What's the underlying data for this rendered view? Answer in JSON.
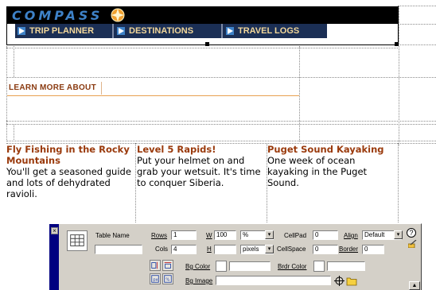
{
  "header": {
    "logo": "COMPASS",
    "nav": [
      {
        "label": "TRIP PLANNER"
      },
      {
        "label": "DESTINATIONS"
      },
      {
        "label": "TRAVEL LOGS"
      }
    ]
  },
  "learn_more": {
    "label": "LEARN MORE ABOUT"
  },
  "columns": [
    {
      "title": "Fly Fishing in the Rocky Mountains",
      "body": "You'll get a seasoned guide and lots of dehydrated ravioli."
    },
    {
      "title": "Level 5 Rapids!",
      "body": "Put your helmet on and grab your wetsuit. It's time to conquer Siberia."
    },
    {
      "title": "Puget Sound Kayaking",
      "body": "One week of ocean kayaking in the Puget Sound."
    }
  ],
  "inspector": {
    "table_name_label": "Table Name",
    "table_name_value": "",
    "rows_label": "Rows",
    "rows_value": "1",
    "cols_label": "Cols",
    "cols_value": "4",
    "w_label": "W",
    "w_value": "100",
    "w_unit": "%",
    "h_label": "H",
    "h_value": "",
    "h_unit": "pixels",
    "cellpad_label": "CellPad",
    "cellpad_value": "0",
    "cellspace_label": "CellSpace",
    "cellspace_value": "0",
    "align_label": "Align",
    "align_value": "Default",
    "border_label": "Border",
    "border_value": "0",
    "bgcolor_label": "Bg Color",
    "bgcolor_value": "",
    "brdrcolor_label": "Brdr Color",
    "brdrcolor_value": "",
    "bgimage_label": "Bg Image",
    "bgimage_value": "",
    "help_glyph": "?",
    "close_glyph": "×",
    "select_arrow": "▾",
    "expander_glyph": "▲"
  },
  "colors": {
    "logo": "#3e82c8",
    "nav_bg": "#1b2f55",
    "nav_text": "#f2d79a",
    "title": "#9a3a0c",
    "panel": "#d4d0c8"
  }
}
